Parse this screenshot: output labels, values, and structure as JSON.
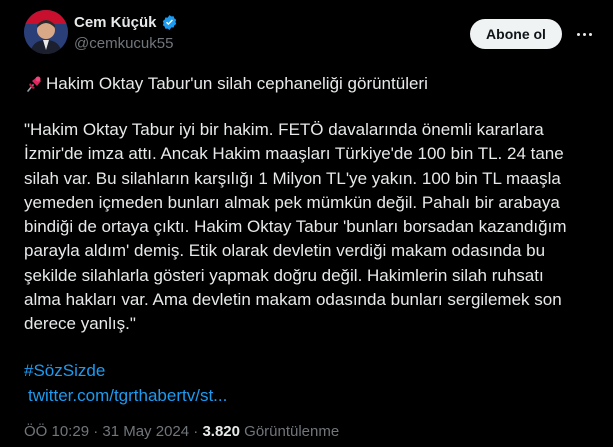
{
  "author": {
    "name": "Cem Küçük",
    "handle": "@cemkucuk55",
    "verified_color": "#1d9bf0"
  },
  "follow_button": {
    "label": "Abone ol"
  },
  "tweet": {
    "headline_icon": "pushpin-icon",
    "headline": "Hakim Oktay Tabur'un silah cephaneliği görüntüleri",
    "body_lines": [
      "\"Hakim Oktay Tabur iyi bir hakim. FETÖ davalarında önemli kararlara",
      "İzmir'de imza attı. Ancak Hakim maaşları Türkiye'de 100 bin TL. 24 tane",
      "silah var. Bu silahların karşılığı 1 Milyon TL'ye yakın. 100 bin TL maaşla",
      "yemeden içmeden bunları almak pek mümkün değil. Pahalı bir arabaya",
      "bindiği de ortaya çıktı. Hakim Oktay Tabur 'bunları borsadan kazandığım",
      "parayla aldım' demiş.  Etik olarak devletin verdiği makam odasında bu",
      "şekilde silahlarla gösteri yapmak doğru değil. Hakimlerin silah ruhsatı",
      "alma hakları var. Ama devletin makam odasında bunları sergilemek son",
      "derece yanlış.\""
    ],
    "hashtag": "#SözSizde",
    "link": "twitter.com/tgrthabertv/st..."
  },
  "meta": {
    "time_date": "ÖÖ 10:29 · 31 May 2024 · ",
    "views_count": "3.820",
    "views_label": " Görüntülenme"
  },
  "colors": {
    "background": "#000000",
    "text": "#e7e9ea",
    "secondary": "#71767b",
    "accent": "#1d9bf0"
  }
}
